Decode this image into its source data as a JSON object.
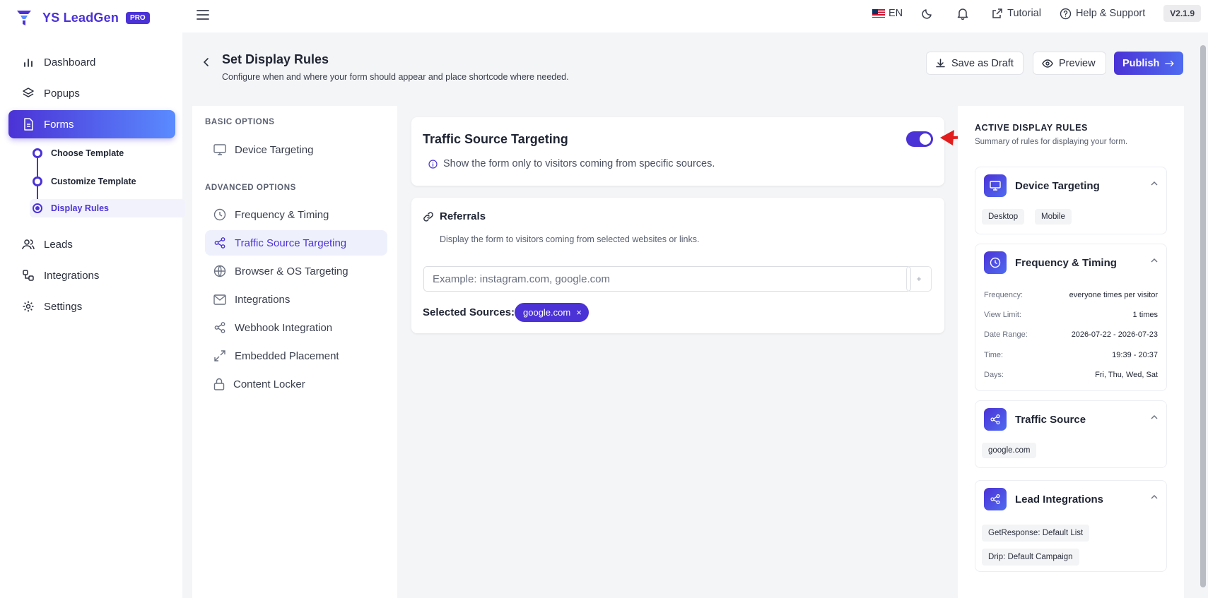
{
  "app": {
    "name": "YS LeadGen",
    "badge": "PRO",
    "version": "V2.1.9"
  },
  "sidebar": {
    "items": [
      {
        "label": "Dashboard"
      },
      {
        "label": "Popups"
      },
      {
        "label": "Forms"
      },
      {
        "label": "Leads"
      },
      {
        "label": "Integrations"
      },
      {
        "label": "Settings"
      }
    ],
    "forms_sub": [
      {
        "label": "Choose Template"
      },
      {
        "label": "Customize Template"
      },
      {
        "label": "Display Rules"
      }
    ]
  },
  "topbar": {
    "language": "EN",
    "tutorial": "Tutorial",
    "help": "Help & Support"
  },
  "header": {
    "title": "Set Display Rules",
    "subtitle": "Configure when and where your form should appear and place shortcode where needed.",
    "save_draft": "Save as Draft",
    "preview": "Preview",
    "publish": "Publish"
  },
  "options": {
    "basic_label": "BASIC OPTIONS",
    "advanced_label": "ADVANCED OPTIONS",
    "items": [
      "Device Targeting",
      "Frequency & Timing",
      "Traffic Source Targeting",
      "Browser & OS Targeting",
      "Integrations",
      "Webhook Integration",
      "Embedded Placement",
      "Content Locker"
    ]
  },
  "main": {
    "title": "Traffic Source Targeting",
    "enabled": true,
    "description": "Show the form only to visitors coming from specific sources.",
    "referrals": {
      "title": "Referrals",
      "description": "Display the form to visitors coming from selected websites or links.",
      "placeholder": "Example: instagram.com, google.com",
      "add": "+",
      "selected_label": "Selected Sources:",
      "selected": [
        "google.com"
      ],
      "remove": "×"
    }
  },
  "rules": {
    "title": "ACTIVE DISPLAY RULES",
    "subtitle": "Summary of rules for displaying your form.",
    "device": {
      "title": "Device Targeting",
      "tags": [
        "Desktop",
        "Mobile"
      ]
    },
    "frequency": {
      "title": "Frequency & Timing",
      "rows": [
        {
          "k": "Frequency:",
          "v": "everyone times per visitor"
        },
        {
          "k": "View Limit:",
          "v": "1 times"
        },
        {
          "k": "Date Range:",
          "v": "2026-07-22 - 2026-07-23"
        },
        {
          "k": "Time:",
          "v": "19:39 - 20:37"
        },
        {
          "k": "Days:",
          "v": "Fri, Thu, Wed, Sat"
        }
      ]
    },
    "traffic": {
      "title": "Traffic Source",
      "tags": [
        "google.com"
      ]
    },
    "leads": {
      "title": "Lead Integrations",
      "tags": [
        "GetResponse: Default List",
        "Drip: Default Campaign"
      ]
    }
  },
  "colors": {
    "accent": "#4b32d6",
    "arrow": "#e11d1d"
  }
}
